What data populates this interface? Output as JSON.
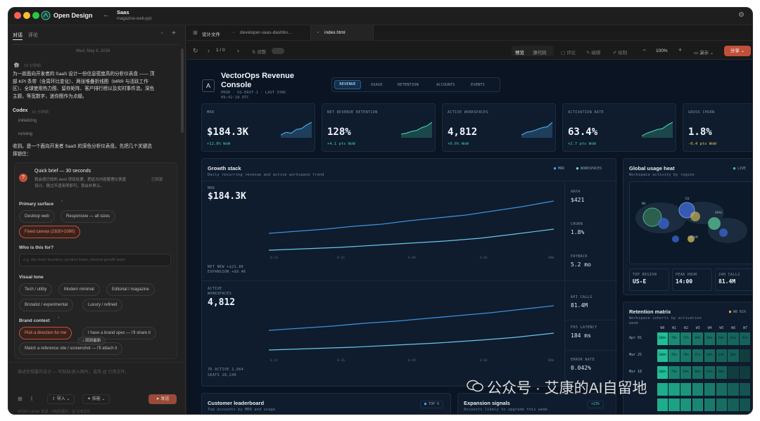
{
  "app": {
    "name": "Open Design",
    "project": "Saas",
    "subproject": "magazine-web-ppt"
  },
  "left": {
    "tabs": [
      "对话",
      "评论"
    ],
    "date": "Wed, May 8, 2026",
    "user_name": "你",
    "user_time": "19 分钟前",
    "user_msg": [
      "为一款面向开发者的 SaaS 设计一份信息密度高的分析仪表盘 —— 顶",
      "部 KPI 条带（含周环比变化）、两张堆叠折线图（MRR 与活跃工作",
      "区）、全球使用热力图、留存矩阵、客户排行榜以及实时事件流。深色",
      "主题，等宽数字，迷你图作为点缀。"
    ],
    "agent_name": "Codex",
    "agent_time": "19 分钟前",
    "status1": "initializing",
    "status2": "running",
    "reply": [
      "收到。是一个面向开发者 SaaS 的深色分析仪表盘。先把几个关键选",
      "择锁住："
    ],
    "brief_title": "Quick brief — 30 seconds",
    "brief_text": [
      "我会按已知的 deck 项目处理，把这次内容整理仪表盘",
      "设计。跳过不适用项即可，我会补默认。"
    ],
    "brief_status": "已回复",
    "q1": "Primary surface",
    "q1_opts": [
      "Desktop web",
      "Responsive — all sizes",
      "Fixed canvas (1920×1080)"
    ],
    "q2": "Who is this for?",
    "q2_placeholder": "e.g. dev-tools founders, product leads, internal growth team",
    "q3": "Visual tone",
    "q3_opts": [
      "Tech / utility",
      "Modern minimal",
      "Editorial / magazine",
      "Brutalist / experimental",
      "Luxury / refined"
    ],
    "q4": "Brand context",
    "q4_opts": [
      "Pick a direction for me",
      "I have a brand spec — I'll share it",
      "Match a reference site / screenshot — I'll attach it"
    ],
    "back_bottom": "回到最新",
    "input_placeholder": "描述你想要的设计 — 可粘贴/拖入图片，或用 @ 引用文件。",
    "import": "导入",
    "skills": "技能",
    "send": "发送",
    "hint": "⌘/Ctrl + Enter 发送 · 可粘贴图片 · @ 引用文件"
  },
  "tabs": [
    "设计文件",
    "developer-saas-dashbo...",
    "index.html"
  ],
  "toolbar": {
    "page": "1 / 0",
    "adjust": "调整",
    "preview": "预览",
    "source": "源代码",
    "comment": "评论",
    "edit": "编辑",
    "draw": "绘制",
    "zoom": "100%",
    "present": "演示",
    "share": "分享"
  },
  "dash": {
    "title1": "VectorOps Revenue",
    "title2": "Console",
    "meta1": "PROD · US-EAST-1 · LAST SYNC",
    "meta2": "09:42:18 UTC",
    "nav": [
      "REVENUE",
      "USAGE",
      "RETENTION",
      "ACCOUNTS",
      "EVENTS"
    ],
    "kpis": [
      {
        "label": "MRR",
        "value": "$184.3K",
        "delta": "+12.8% WoW",
        "trend": [
          0.15,
          0.3,
          0.25,
          0.45,
          0.5,
          0.7,
          0.85
        ]
      },
      {
        "label": "NET REVENUE RETENTION",
        "value": "128%",
        "delta": "+4.1 pts WoW",
        "trend": [
          0.2,
          0.25,
          0.35,
          0.4,
          0.55,
          0.65,
          0.85
        ]
      },
      {
        "label": "ACTIVE WORKSPACES",
        "value": "4,812",
        "delta": "+9.6% WoW",
        "trend": [
          0.15,
          0.3,
          0.35,
          0.45,
          0.55,
          0.6,
          0.85
        ]
      },
      {
        "label": "ACTIVATION RATE",
        "value": "63.4%",
        "delta": "+2.7 pts WoW",
        "trend": [
          0.1,
          0.25,
          0.35,
          0.45,
          0.5,
          0.7,
          0.85
        ]
      },
      {
        "label": "GROSS CHURN",
        "value": "1.8%",
        "delta": "-0.4 pts WoW"
      }
    ],
    "growth_title": "Growth stack",
    "growth_sub": "Daily recurring revenue and active workspace trend",
    "legend": [
      "MRR",
      "WORKSPACES"
    ],
    "mrr_label": "MRR",
    "mrr_value": "$184.3K",
    "mrr_foot1": "NET NEW +$21.8K",
    "mrr_foot2": "EXPANSION +$9.4K",
    "ticks": [
      "0-14",
      "0-16",
      "0-09",
      "0-02",
      "NOW"
    ],
    "arpa_l": "ARPA",
    "arpa_v": "$421",
    "churn_l": "CHURN",
    "churn_v": "1.8%",
    "payback_l": "PAYBACK",
    "payback_v": "5.2 mo",
    "aw_l1": "ACTIVE",
    "aw_l2": "WORKSPACES",
    "aw_value": "4,812",
    "aw_foot1": "7D ACTIVE 2,964",
    "aw_foot2": "SEATS 28,240",
    "api_l": "API CALLS",
    "api_v": "81.4M",
    "p95_l": "P95 LATENCY",
    "p95_v": "184 ms",
    "err_l": "ERROR RATE",
    "err_v": "0.042%",
    "heat_title": "Global usage heat",
    "heat_sub": "Workspace activity by region",
    "live": "LIVE",
    "regions": [
      "NA",
      "EU",
      "APAC",
      "LATAM"
    ],
    "top_region_l": "TOP REGION",
    "top_region_v": "US-E",
    "peak_l": "PEAK HOUR",
    "peak_v": "14:00",
    "calls_l": "24H CALLS",
    "calls_v": "81.4M",
    "ret_title": "Retention matrix",
    "ret_sub1": "Workspace cohorts by activation",
    "ret_sub2": "week",
    "ret_badge": "W8 61%",
    "ret_cols": [
      "W0",
      "W1",
      "W2",
      "W3",
      "W4",
      "W5",
      "W6",
      "W7"
    ],
    "ret_rows": [
      {
        "label": "Apr 01",
        "cells": [
          "100%",
          "78%",
          "72%",
          "69%",
          "66%",
          "64%",
          "62%",
          "61%"
        ]
      },
      {
        "label": "Mar 25",
        "cells": [
          "100%",
          "76%",
          "70%",
          "67%",
          "64%",
          "61%",
          "60%",
          ""
        ]
      },
      {
        "label": "Mar 18",
        "cells": [
          "100%",
          "74%",
          "69%",
          "66%",
          "63%",
          "60%",
          "",
          ""
        ]
      }
    ],
    "leader_title": "Customer leaderboard",
    "leader_sub": "Top accounts by MRR and usage",
    "leader_badge": "TOP 6",
    "exp_title": "Expansion signals",
    "exp_sub": "Accounts likely to upgrade this week",
    "exp_badge": "+23%"
  },
  "watermark": "公众号 · 艾康的AI自留地",
  "colors": {
    "accent": "#c0503a",
    "teal": "#3ec9a2",
    "blue": "#4aa3e8",
    "bg": "#0a1422"
  }
}
